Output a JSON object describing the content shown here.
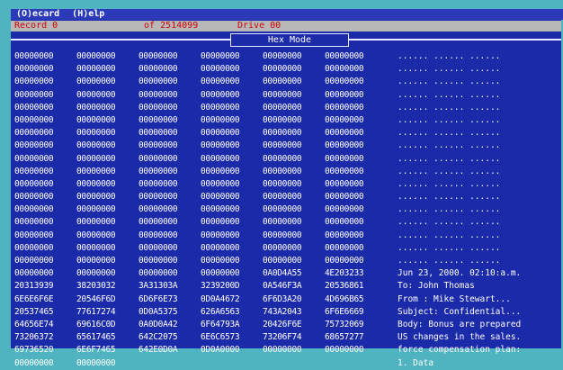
{
  "menu": {
    "items": [
      "(O)ecard",
      "(H)elp"
    ]
  },
  "status": {
    "record_label": "Record",
    "record_value": "0",
    "offset_label": "of",
    "offset_value": "2514099",
    "drive_label": "Drive",
    "drive_value": "00"
  },
  "mode": {
    "label": "Hex Mode"
  },
  "hex_rows": [
    [
      "00000000",
      "00000000",
      "00000000",
      "00000000",
      "00000000",
      "00000000"
    ],
    [
      "00000000",
      "00000000",
      "00000000",
      "00000000",
      "00000000",
      "00000000"
    ],
    [
      "00000000",
      "00000000",
      "00000000",
      "00000000",
      "00000000",
      "00000000"
    ],
    [
      "00000000",
      "00000000",
      "00000000",
      "00000000",
      "00000000",
      "00000000"
    ],
    [
      "00000000",
      "00000000",
      "00000000",
      "00000000",
      "00000000",
      "00000000"
    ],
    [
      "00000000",
      "00000000",
      "00000000",
      "00000000",
      "00000000",
      "00000000"
    ],
    [
      "00000000",
      "00000000",
      "00000000",
      "00000000",
      "00000000",
      "00000000"
    ],
    [
      "00000000",
      "00000000",
      "00000000",
      "00000000",
      "00000000",
      "00000000"
    ],
    [
      "00000000",
      "00000000",
      "00000000",
      "00000000",
      "00000000",
      "00000000"
    ],
    [
      "00000000",
      "00000000",
      "00000000",
      "00000000",
      "00000000",
      "00000000"
    ],
    [
      "00000000",
      "00000000",
      "00000000",
      "00000000",
      "00000000",
      "00000000"
    ],
    [
      "00000000",
      "00000000",
      "00000000",
      "00000000",
      "00000000",
      "00000000"
    ],
    [
      "00000000",
      "00000000",
      "00000000",
      "00000000",
      "00000000",
      "00000000"
    ],
    [
      "00000000",
      "00000000",
      "00000000",
      "00000000",
      "00000000",
      "00000000"
    ],
    [
      "00000000",
      "00000000",
      "00000000",
      "00000000",
      "00000000",
      "00000000"
    ],
    [
      "00000000",
      "00000000",
      "00000000",
      "00000000",
      "00000000",
      "00000000"
    ],
    [
      "00000000",
      "00000000",
      "00000000",
      "00000000",
      "00000000",
      "00000000"
    ],
    [
      "00000000",
      "00000000",
      "00000000",
      "00000000",
      "0A0D4A55",
      "4E203233"
    ],
    [
      "20313939",
      "38203032",
      "3A31303A",
      "3239200D",
      "0A546F3A",
      "20536861"
    ],
    [
      "6E6E6F6E",
      "20546F6D",
      "6D6F6E73",
      "0D0A4672",
      "6F6D3A20",
      "4D696B65"
    ],
    [
      "20537465",
      "77617274",
      "0D0A5375",
      "626A6563",
      "743A2043",
      "6F6E6669"
    ],
    [
      "64656E74",
      "69616C0D",
      "0A0D0A42",
      "6F64793A",
      "20426F6E",
      "75732069"
    ],
    [
      "73206372",
      "65617465",
      "642C2075",
      "6E6C6573",
      "73206F74",
      "68657277"
    ],
    [
      "69736520",
      "6E6F7465",
      "642E0D0A",
      "0D0A0000",
      "00000000",
      "00000000"
    ],
    [
      "00000000",
      "00000000",
      "",
      "",
      "",
      ""
    ]
  ],
  "ascii_rows": [
    "...... ...... ......",
    "...... ...... ......",
    "...... ...... ......",
    "...... ...... ......",
    "...... ...... ......",
    "...... ...... ......",
    "...... ...... ......",
    "...... ...... ......",
    "...... ...... ......",
    "...... ...... ......",
    "...... ...... ......",
    "...... ...... ......",
    "...... ...... ......",
    "...... ...... ......",
    "...... ...... ......",
    "...... ...... ......",
    "...... ...... ......",
    "Jun 23, 2000. 02:10:a.m.",
    "To: John Thomas",
    "From : Mike Stewart...",
    "Subject: Confidential...",
    "Body: Bonus are prepared",
    "US changes in the sales.",
    "force compensation plan:",
    "1. Data"
  ]
}
